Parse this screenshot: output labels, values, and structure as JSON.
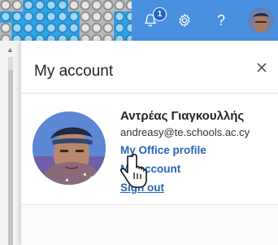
{
  "header": {
    "notifications": {
      "icon": "bell-icon",
      "badge_count": "1"
    },
    "settings": {
      "icon": "gear-icon"
    },
    "help": {
      "icon": "question-icon",
      "label": "?"
    },
    "avatar": {
      "icon": "user-avatar"
    },
    "colors": {
      "bar": "#4a90e0",
      "badge": "#2266c4"
    }
  },
  "panel": {
    "title": "My account",
    "close_icon": "close-icon",
    "user": {
      "name": "Αντρέας Γιαγκουλλής",
      "email": "andreasy@te.schools.ac.cy"
    },
    "links": {
      "office_profile": "My Office profile",
      "my_account": "My account",
      "sign_out": "Sign out"
    },
    "colors": {
      "link": "#2764b8",
      "text": "#252423"
    }
  },
  "cursor": {
    "icon": "hand-pointer-icon"
  }
}
